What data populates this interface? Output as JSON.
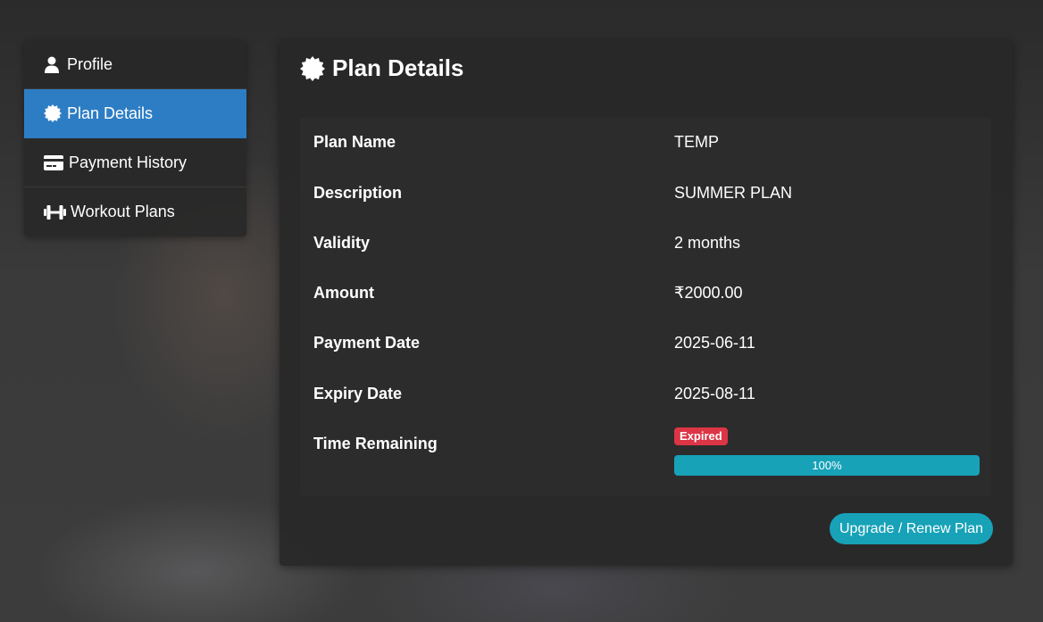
{
  "sidebar": {
    "items": [
      {
        "label": "Profile",
        "icon": "user-icon",
        "active": false
      },
      {
        "label": "Plan Details",
        "icon": "certificate-icon",
        "active": true
      },
      {
        "label": "Payment History",
        "icon": "credit-card-icon",
        "active": false
      },
      {
        "label": "Workout Plans",
        "icon": "dumbbell-icon",
        "active": false
      }
    ]
  },
  "main": {
    "title": "Plan Details",
    "title_icon": "certificate-icon",
    "details": {
      "plan_name": {
        "label": "Plan Name",
        "value": "TEMP"
      },
      "description": {
        "label": "Description",
        "value": "SUMMER PLAN"
      },
      "validity": {
        "label": "Validity",
        "value": "2 months"
      },
      "amount": {
        "label": "Amount",
        "value": "₹2000.00"
      },
      "payment_date": {
        "label": "Payment Date",
        "value": "2025-06-11"
      },
      "expiry_date": {
        "label": "Expiry Date",
        "value": "2025-08-11"
      },
      "time_remaining": {
        "label": "Time Remaining",
        "status": "Expired",
        "progress_percent": 100,
        "progress_label": "100%"
      }
    },
    "upgrade_button": "Upgrade / Renew Plan"
  },
  "colors": {
    "active_nav": "#2d7dc4",
    "accent": "#17a2b8",
    "danger": "#dc3545"
  }
}
